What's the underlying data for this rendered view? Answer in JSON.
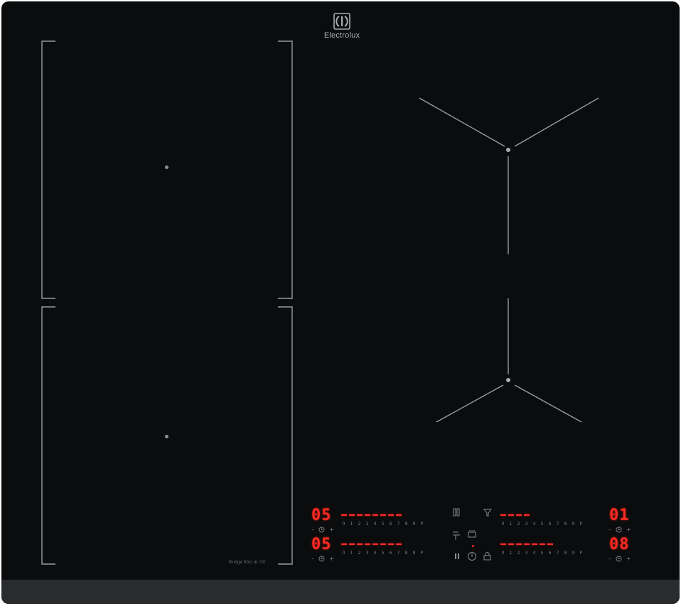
{
  "brand": {
    "name": "Electrolux",
    "logo_icon": "electrolux-logo-icon"
  },
  "model_label": "Bridge 60cl ⊕ 7/0",
  "colors": {
    "glass": "#0b0c0d",
    "lines": "#9a9c9f",
    "display": "#ff2a22",
    "frame": "#2a2b2d"
  },
  "scale_labels": [
    "0",
    "1",
    "2",
    "3",
    "4",
    "5",
    "6",
    "7",
    "8",
    "9",
    "P"
  ],
  "zones": {
    "front_left": {
      "display": "05",
      "level_bars": 8,
      "minus": "–",
      "plus": "+"
    },
    "rear_left": {
      "display": "05",
      "level_bars": 8,
      "minus": "–",
      "plus": "+"
    },
    "rear_right": {
      "display": "01",
      "level_bars": 4,
      "minus": "–",
      "plus": "+"
    },
    "front_right": {
      "display": "08",
      "level_bars": 7,
      "minus": "–",
      "plus": "+"
    }
  },
  "center_controls": {
    "bridge_icon": "bridge-icon",
    "hob2hood_icon": "hood-icon",
    "keep_warm_icon": "keep-warm-icon",
    "boil_icon": "pot-icon",
    "pause_icon": "pause-icon",
    "power_icon": "power-icon",
    "lock_icon": "lock-icon"
  }
}
